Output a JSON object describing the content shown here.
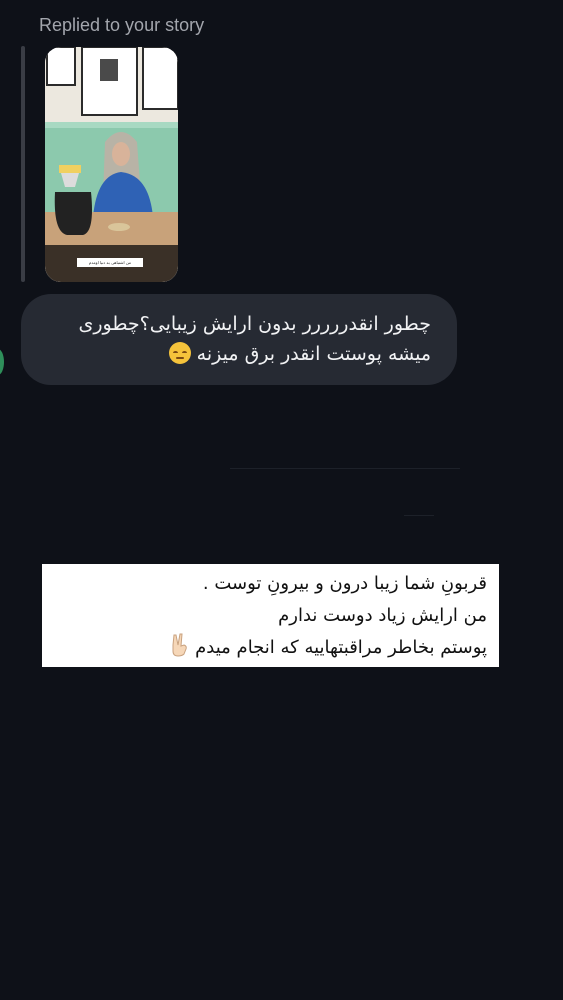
{
  "conversation": {
    "replied_label": "Replied to your story",
    "story": {
      "caption": "من اشتباهی به دنیا اومدم"
    },
    "received_message": {
      "line1": "چطور انقدررررر بدون ارایش زیبایی؟چطوری",
      "line2": "میشه پوستت انقدر برق میزنه",
      "emoji": "relieved-face-icon"
    },
    "reply": {
      "line1": "قربونِ شما زیبا درون و بیرونِ توست .",
      "line2": "من ارایش زیاد دوست ندارم",
      "line3": "پوستم بخاطر مراقبتهاییه که انجام میدم",
      "emoji": "victory-hand-icon"
    }
  },
  "colors": {
    "background": "#0e1118",
    "bubble": "#262a33",
    "label": "#a3a6ad",
    "accent_marker": "#2e8f5a"
  }
}
